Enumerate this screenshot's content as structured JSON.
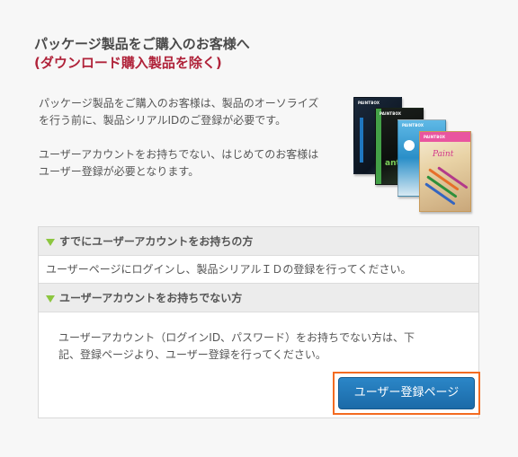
{
  "heading": {
    "line1": "パッケージ製品をご購入のお客様へ",
    "line2": "(ダウンロード購入製品を除く)"
  },
  "intro": {
    "p1_line1": "パッケージ製品をご購入のお客様は、製品のオーソライズ",
    "p1_line2": "を行う前に、製品シリアルIDのご登録が必要です。",
    "p2_line1": "ユーザーアカウントをお持ちでない、はじめてのお客様は",
    "p2_line2": "ユーザー登録が必要となります。"
  },
  "product_image": {
    "boxes": [
      {
        "brand": "PAINTBOX",
        "color": "#0b1420"
      },
      {
        "brand": "PAINTBOX",
        "text": "anti",
        "color": "#43a047"
      },
      {
        "brand": "PAINTBOX",
        "color": "#2a8fc8"
      },
      {
        "brand": "PAINTBOX",
        "text": "Paint",
        "color": "#e9559f"
      }
    ]
  },
  "panel": {
    "section1_title": "すでにユーザーアカウントをお持ちの方",
    "section1_body": "ユーザーページにログインし、製品シリアルＩＤの登録を行ってください。",
    "section2_title": "ユーザーアカウントをお持ちでない方",
    "section2_body_line1": "ユーザーアカウント（ログインID、パスワード）をお持ちでない方は、下",
    "section2_body_line2": "記、登録ページより、ユーザー登録を行ってください。",
    "button_label": "ユーザー登録ページ"
  },
  "colors": {
    "accent_red": "#b0233a",
    "triangle_green": "#8cc63f",
    "button_blue": "#1b6aa8",
    "highlight_orange": "#f36b21"
  }
}
